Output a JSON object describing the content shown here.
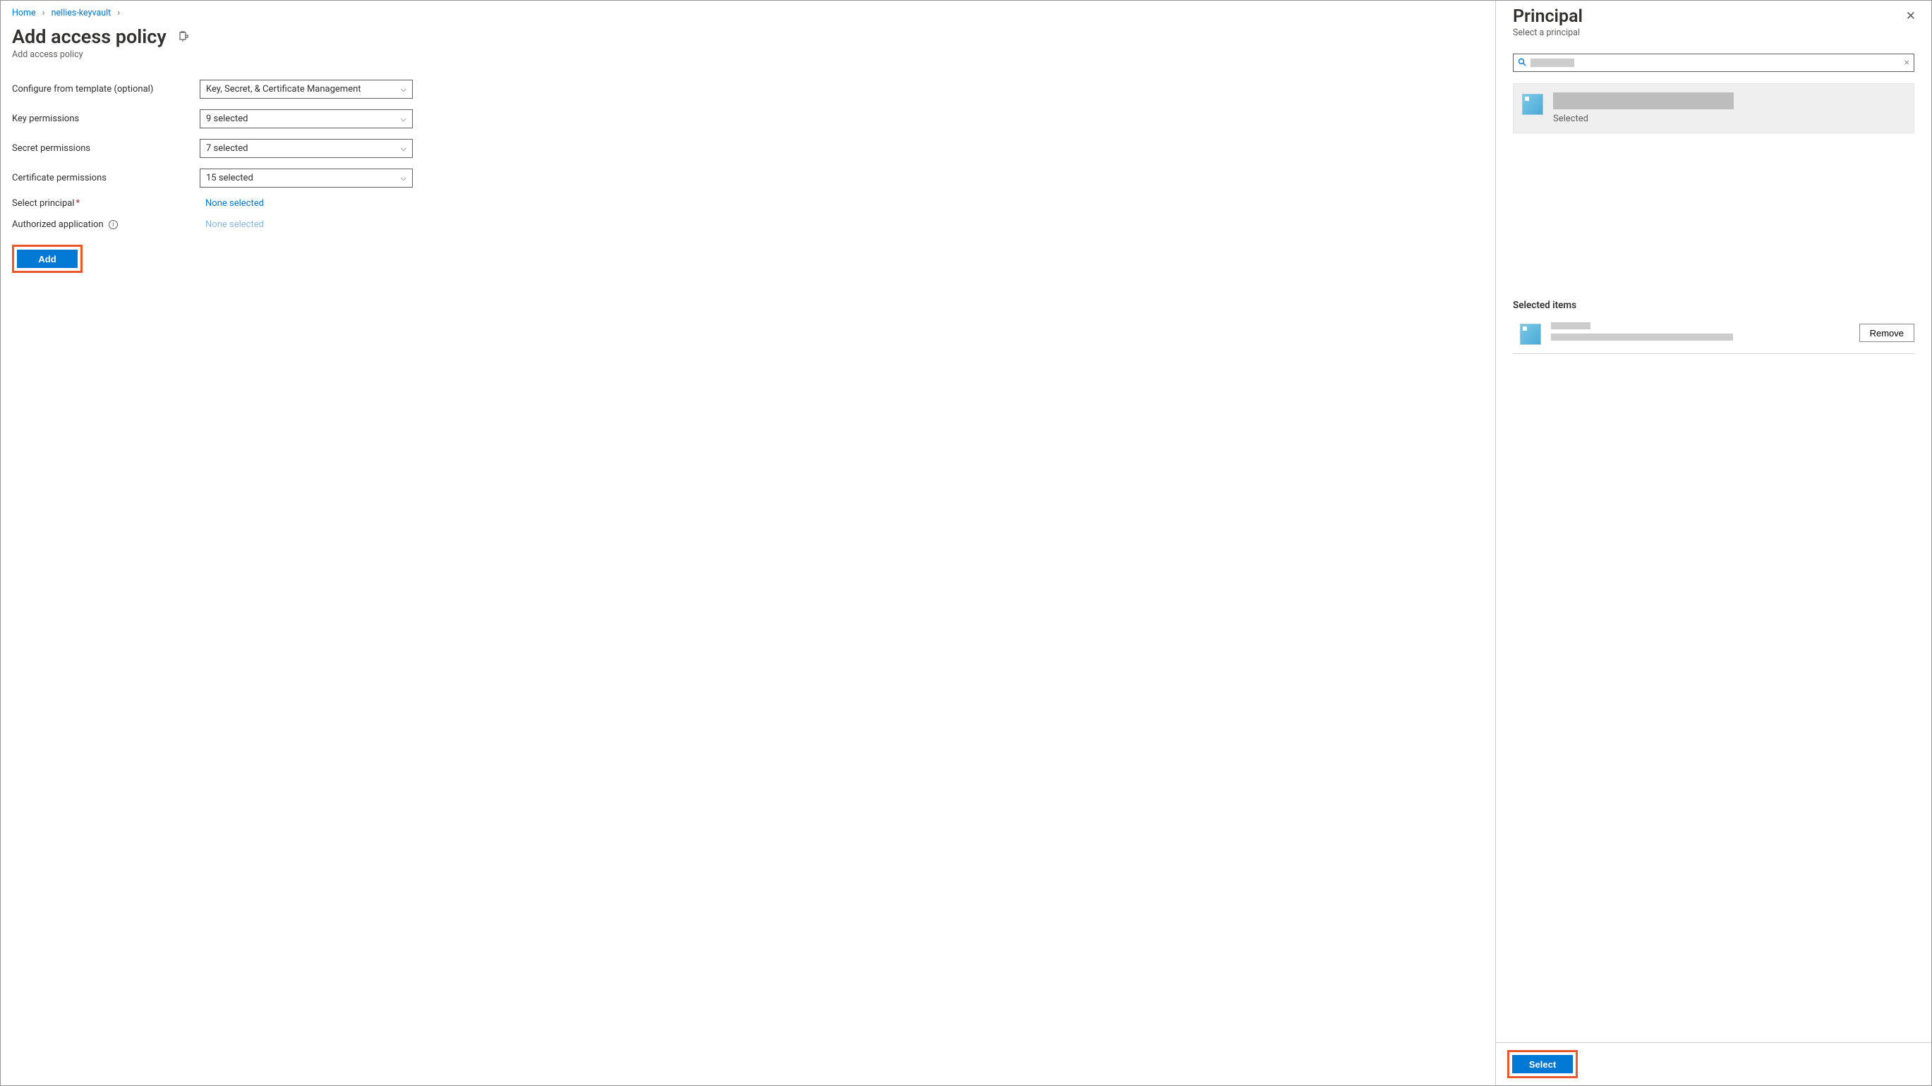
{
  "breadcrumb": {
    "home": "Home",
    "vault": "nellies-keyvault"
  },
  "header": {
    "title": "Add access policy",
    "subtitle": "Add access policy"
  },
  "form": {
    "template_label": "Configure from template (optional)",
    "template_value": "Key, Secret, & Certificate Management",
    "key_label": "Key permissions",
    "key_value": "9 selected",
    "secret_label": "Secret permissions",
    "secret_value": "7 selected",
    "cert_label": "Certificate permissions",
    "cert_value": "15 selected",
    "principal_label": "Select principal",
    "principal_value": "None selected",
    "authorized_label": "Authorized application",
    "authorized_value": "None selected",
    "add_button": "Add"
  },
  "panel": {
    "title": "Principal",
    "subtitle": "Select a principal",
    "result_status": "Selected",
    "selected_heading": "Selected items",
    "remove": "Remove",
    "select_button": "Select"
  }
}
